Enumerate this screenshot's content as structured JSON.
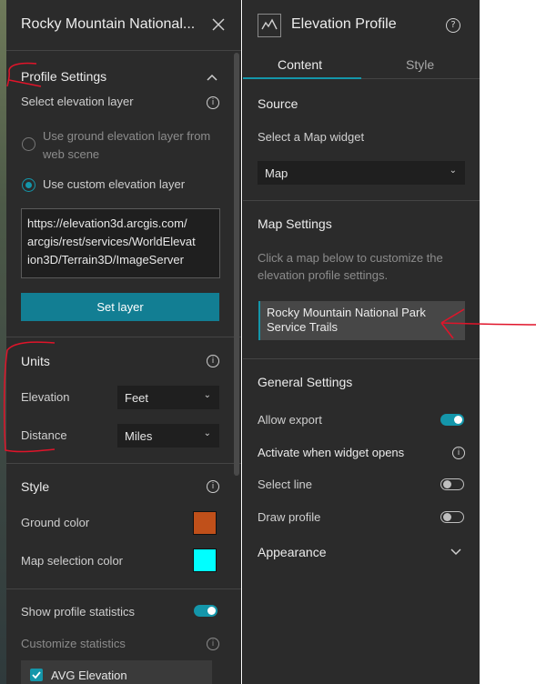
{
  "left_panel": {
    "title": "Rocky Mountain National...",
    "profile_settings": {
      "header": "Profile Settings",
      "select_layer_label": "Select elevation layer",
      "radio_ground_line1": "Use ground elevation layer from",
      "radio_ground_line2": "web scene",
      "radio_custom": "Use custom elevation layer",
      "url_line1": "https://elevation3d.arcgis.com/",
      "url_line2": "arcgis/rest/services/WorldElevat",
      "url_line3": "ion3D/Terrain3D/ImageServer",
      "set_layer_button": "Set layer"
    },
    "units": {
      "header": "Units",
      "elevation_label": "Elevation",
      "elevation_value": "Feet",
      "distance_label": "Distance",
      "distance_value": "Miles"
    },
    "style": {
      "header": "Style",
      "ground_color_label": "Ground color",
      "ground_color": "#c0501a",
      "map_selection_label": "Map selection color",
      "map_selection_color": "#00ffff",
      "show_stats_label": "Show profile statistics",
      "customize_stats_label": "Customize statistics",
      "avg_elevation_label": "AVG Elevation"
    }
  },
  "right_panel": {
    "title": "Elevation Profile",
    "tabs": {
      "content": "Content",
      "style": "Style"
    },
    "source": {
      "header": "Source",
      "select_map_label": "Select a Map widget",
      "map_value": "Map"
    },
    "map_settings": {
      "header": "Map Settings",
      "desc_line1": "Click a map below to customize the",
      "desc_line2": "elevation profile settings.",
      "map_item_line1": "Rocky Mountain National Park",
      "map_item_line2": "Service Trails"
    },
    "general_settings": {
      "header": "General Settings",
      "allow_export": "Allow export",
      "activate_on_open": "Activate when widget opens",
      "select_line": "Select line",
      "draw_profile": "Draw profile"
    },
    "appearance": {
      "header": "Appearance"
    }
  },
  "colors": {
    "accent": "#1496aa",
    "panel_bg": "#2b2b2b",
    "annotation": "#e0142a"
  },
  "icons": [
    "close-icon",
    "chevron-up-icon",
    "info-icon",
    "chevron-down-icon",
    "elevation-profile-icon",
    "help-icon",
    "check-icon"
  ]
}
